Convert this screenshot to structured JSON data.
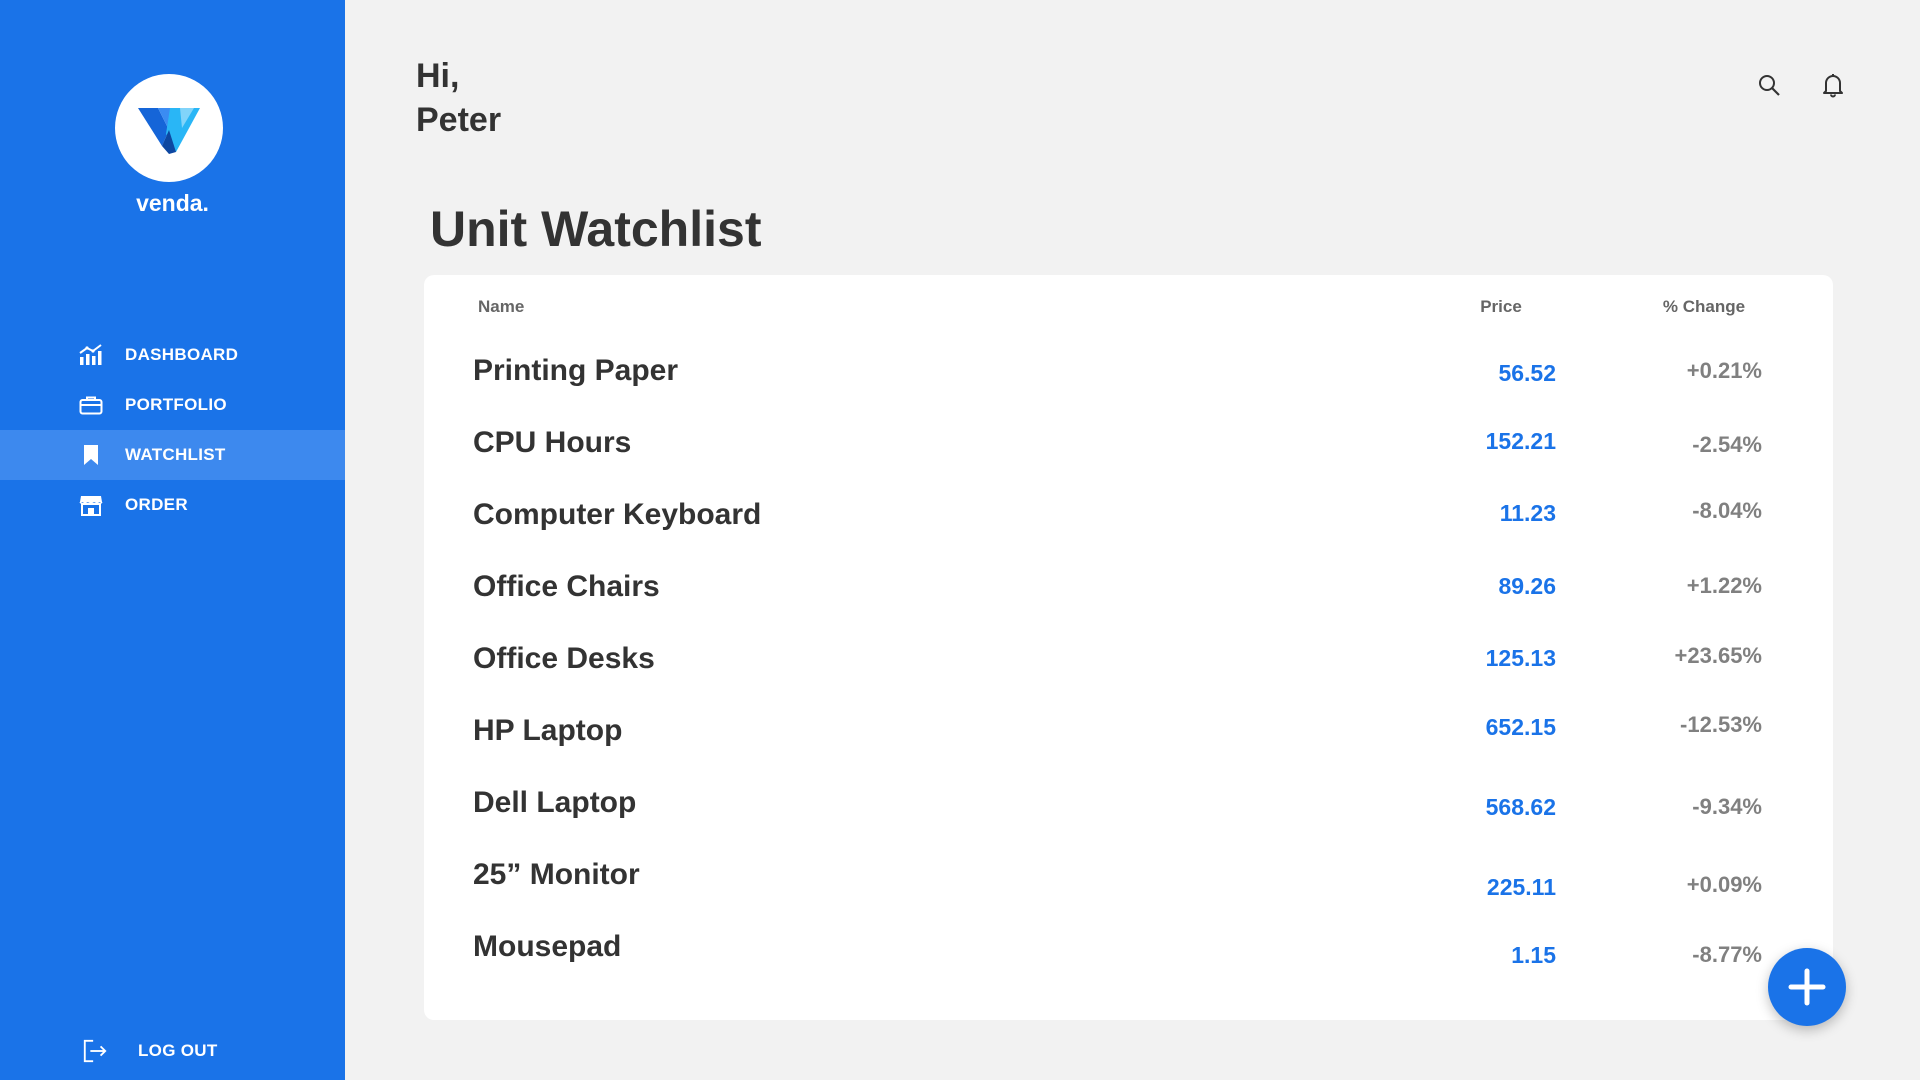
{
  "brand": {
    "name": "venda.",
    "primary_color": "#1a73e8",
    "active_color": "#3d89ee"
  },
  "greeting": {
    "line1": "Hi,",
    "line2": "Peter"
  },
  "icons": {
    "search": "search-icon",
    "bell": "bell-icon",
    "add": "plus-icon"
  },
  "sidebar": {
    "items": [
      {
        "label": "DASHBOARD",
        "icon": "chart-icon",
        "active": false
      },
      {
        "label": "PORTFOLIO",
        "icon": "briefcase-icon",
        "active": false
      },
      {
        "label": "WATCHLIST",
        "icon": "bookmark-icon",
        "active": true
      },
      {
        "label": "ORDER",
        "icon": "store-icon",
        "active": false
      }
    ],
    "logout_label": "LOG OUT"
  },
  "page": {
    "title": "Unit Watchlist"
  },
  "table": {
    "headers": {
      "name": "Name",
      "price": "Price",
      "change": "% Change"
    },
    "rows": [
      {
        "name": "Printing Paper",
        "price": "56.52",
        "change": "+0.21%"
      },
      {
        "name": "CPU Hours",
        "price": "152.21",
        "change": "-2.54%"
      },
      {
        "name": "Computer Keyboard",
        "price": "11.23",
        "change": "-8.04%"
      },
      {
        "name": "Office Chairs",
        "price": "89.26",
        "change": "+1.22%"
      },
      {
        "name": "Office Desks",
        "price": "125.13",
        "change": "+23.65%"
      },
      {
        "name": "HP Laptop",
        "price": "652.15",
        "change": "-12.53%"
      },
      {
        "name": "Dell Laptop",
        "price": "568.62",
        "change": "-9.34%"
      },
      {
        "name": "25” Monitor",
        "price": "225.11",
        "change": "+0.09%"
      },
      {
        "name": "Mousepad",
        "price": "1.15",
        "change": "-8.77%"
      }
    ]
  }
}
